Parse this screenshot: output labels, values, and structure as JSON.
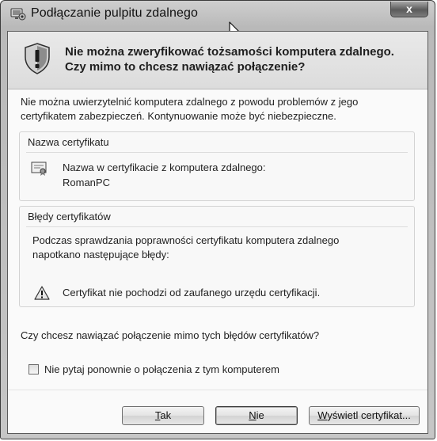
{
  "window": {
    "title": "Podłączanie pulpitu zdalnego",
    "close_label": "x"
  },
  "header": {
    "headline_line1": "Nie można zweryfikować tożsamości komputera zdalnego.",
    "headline_line2": "Czy mimo to chcesz nawiązać połączenie?"
  },
  "intro": {
    "line1": "Nie można uwierzytelnić komputera zdalnego z powodu problemów z jego",
    "line2": "certyfikatem zabezpieczeń. Kontynuowanie może być niebezpieczne."
  },
  "cert_name_group": {
    "title": "Nazwa certyfikatu",
    "label": "Nazwa w certyfikacie z komputera zdalnego:",
    "value": "RomanPC"
  },
  "cert_errors_group": {
    "title": "Błędy certyfikatów",
    "desc_line1": "Podczas sprawdzania poprawności certyfikatu komputera zdalnego",
    "desc_line2": "napotkano następujące błędy:",
    "error_item": "Certyfikat nie pochodzi od zaufanego urzędu certyfikacji."
  },
  "question": "Czy chcesz nawiązać połączenie mimo tych błędów certyfikatów?",
  "dont_ask": {
    "checked": false,
    "label": "Nie pytaj ponownie o połączenia z tym komputerem"
  },
  "buttons": {
    "yes_mnemonic": "T",
    "yes_rest": "ak",
    "no_mnemonic": "N",
    "no_rest": "ie",
    "view_mnemonic": "W",
    "view_rest": "yświetl certyfikat..."
  },
  "icons": {
    "app": "remote-desktop-icon",
    "shield": "warning-shield-icon",
    "cert": "certificate-icon",
    "warning": "warning-triangle-icon",
    "cursor": "mouse-cursor-icon"
  }
}
